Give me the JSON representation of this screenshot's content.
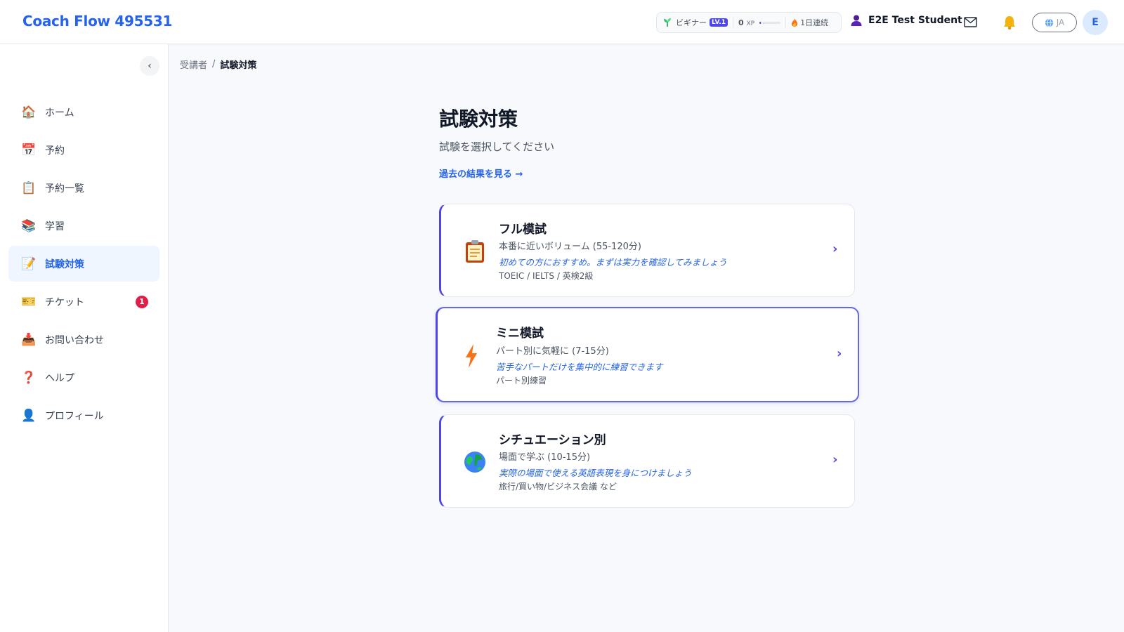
{
  "header": {
    "brand": "Coach Flow 495531",
    "rank": "ビギナー",
    "level": "LV.1",
    "xp_value": "0",
    "xp_unit": "XP",
    "xp_progress": 0.05,
    "streak": "1日連続",
    "user_name": "E2E Test Student",
    "language": "JA",
    "avatar_initial": "E"
  },
  "sidebar": {
    "collapse_glyph": "‹",
    "items": [
      {
        "label": "ホーム",
        "icon": "🏠",
        "icon_name": "house-icon"
      },
      {
        "label": "予約",
        "icon": "📅",
        "icon_name": "calendar-icon"
      },
      {
        "label": "予約一覧",
        "icon": "📋",
        "icon_name": "clipboard-icon"
      },
      {
        "label": "学習",
        "icon": "📚",
        "icon_name": "books-icon"
      },
      {
        "label": "試験対策",
        "icon": "📝",
        "icon_name": "memo-icon"
      },
      {
        "label": "チケット",
        "icon": "🎫",
        "icon_name": "ticket-icon",
        "badge": "1"
      },
      {
        "label": "お問い合わせ",
        "icon": "📥",
        "icon_name": "inbox-icon"
      },
      {
        "label": "ヘルプ",
        "icon": "❓",
        "icon_name": "question-icon"
      },
      {
        "label": "プロフィール",
        "icon": "👤",
        "icon_name": "person-icon"
      }
    ],
    "active_index": 4
  },
  "breadcrumb": {
    "parent": "受講者",
    "separator": "/",
    "current": "試験対策"
  },
  "main": {
    "title": "試験対策",
    "subtitle": "試験を選択してください",
    "history_link": "過去の結果を見る →",
    "cards": [
      {
        "title": "フル模試",
        "desc": "本番に近いボリューム (55-120分)",
        "note": "初めての方におすすめ。まずは実力を確認してみましょう",
        "tags": "TOEIC / IELTS / 英検2級",
        "icon": "clipboard-icon"
      },
      {
        "title": "ミニ模試",
        "desc": "パート別に気軽に (7-15分)",
        "note": "苦手なパートだけを集中的に練習できます",
        "tags": "パート別練習",
        "icon": "lightning-icon"
      },
      {
        "title": "シチュエーション別",
        "desc": "場面で学ぶ (10-15分)",
        "note": "実際の場面で使える英語表現を身につけましょう",
        "tags": "旅行/買い物/ビジネス会議 など",
        "icon": "globe-icon"
      }
    ],
    "chevron": "›"
  },
  "colors": {
    "brand": "#2563eb",
    "accent": "#4f46e5",
    "badge": "#e11d48",
    "active_bg": "#eff6ff"
  }
}
